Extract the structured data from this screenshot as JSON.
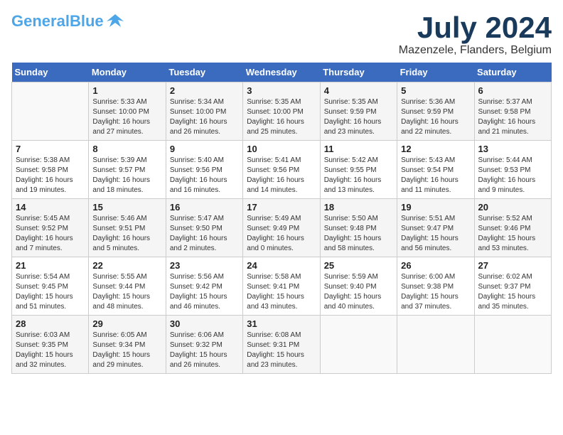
{
  "header": {
    "logo_general": "General",
    "logo_blue": "Blue",
    "month_year": "July 2024",
    "location": "Mazenzele, Flanders, Belgium"
  },
  "days_of_week": [
    "Sunday",
    "Monday",
    "Tuesday",
    "Wednesday",
    "Thursday",
    "Friday",
    "Saturday"
  ],
  "weeks": [
    [
      {
        "day": "",
        "info": ""
      },
      {
        "day": "1",
        "info": "Sunrise: 5:33 AM\nSunset: 10:00 PM\nDaylight: 16 hours\nand 27 minutes."
      },
      {
        "day": "2",
        "info": "Sunrise: 5:34 AM\nSunset: 10:00 PM\nDaylight: 16 hours\nand 26 minutes."
      },
      {
        "day": "3",
        "info": "Sunrise: 5:35 AM\nSunset: 10:00 PM\nDaylight: 16 hours\nand 25 minutes."
      },
      {
        "day": "4",
        "info": "Sunrise: 5:35 AM\nSunset: 9:59 PM\nDaylight: 16 hours\nand 23 minutes."
      },
      {
        "day": "5",
        "info": "Sunrise: 5:36 AM\nSunset: 9:59 PM\nDaylight: 16 hours\nand 22 minutes."
      },
      {
        "day": "6",
        "info": "Sunrise: 5:37 AM\nSunset: 9:58 PM\nDaylight: 16 hours\nand 21 minutes."
      }
    ],
    [
      {
        "day": "7",
        "info": "Sunrise: 5:38 AM\nSunset: 9:58 PM\nDaylight: 16 hours\nand 19 minutes."
      },
      {
        "day": "8",
        "info": "Sunrise: 5:39 AM\nSunset: 9:57 PM\nDaylight: 16 hours\nand 18 minutes."
      },
      {
        "day": "9",
        "info": "Sunrise: 5:40 AM\nSunset: 9:56 PM\nDaylight: 16 hours\nand 16 minutes."
      },
      {
        "day": "10",
        "info": "Sunrise: 5:41 AM\nSunset: 9:56 PM\nDaylight: 16 hours\nand 14 minutes."
      },
      {
        "day": "11",
        "info": "Sunrise: 5:42 AM\nSunset: 9:55 PM\nDaylight: 16 hours\nand 13 minutes."
      },
      {
        "day": "12",
        "info": "Sunrise: 5:43 AM\nSunset: 9:54 PM\nDaylight: 16 hours\nand 11 minutes."
      },
      {
        "day": "13",
        "info": "Sunrise: 5:44 AM\nSunset: 9:53 PM\nDaylight: 16 hours\nand 9 minutes."
      }
    ],
    [
      {
        "day": "14",
        "info": "Sunrise: 5:45 AM\nSunset: 9:52 PM\nDaylight: 16 hours\nand 7 minutes."
      },
      {
        "day": "15",
        "info": "Sunrise: 5:46 AM\nSunset: 9:51 PM\nDaylight: 16 hours\nand 5 minutes."
      },
      {
        "day": "16",
        "info": "Sunrise: 5:47 AM\nSunset: 9:50 PM\nDaylight: 16 hours\nand 2 minutes."
      },
      {
        "day": "17",
        "info": "Sunrise: 5:49 AM\nSunset: 9:49 PM\nDaylight: 16 hours\nand 0 minutes."
      },
      {
        "day": "18",
        "info": "Sunrise: 5:50 AM\nSunset: 9:48 PM\nDaylight: 15 hours\nand 58 minutes."
      },
      {
        "day": "19",
        "info": "Sunrise: 5:51 AM\nSunset: 9:47 PM\nDaylight: 15 hours\nand 56 minutes."
      },
      {
        "day": "20",
        "info": "Sunrise: 5:52 AM\nSunset: 9:46 PM\nDaylight: 15 hours\nand 53 minutes."
      }
    ],
    [
      {
        "day": "21",
        "info": "Sunrise: 5:54 AM\nSunset: 9:45 PM\nDaylight: 15 hours\nand 51 minutes."
      },
      {
        "day": "22",
        "info": "Sunrise: 5:55 AM\nSunset: 9:44 PM\nDaylight: 15 hours\nand 48 minutes."
      },
      {
        "day": "23",
        "info": "Sunrise: 5:56 AM\nSunset: 9:42 PM\nDaylight: 15 hours\nand 46 minutes."
      },
      {
        "day": "24",
        "info": "Sunrise: 5:58 AM\nSunset: 9:41 PM\nDaylight: 15 hours\nand 43 minutes."
      },
      {
        "day": "25",
        "info": "Sunrise: 5:59 AM\nSunset: 9:40 PM\nDaylight: 15 hours\nand 40 minutes."
      },
      {
        "day": "26",
        "info": "Sunrise: 6:00 AM\nSunset: 9:38 PM\nDaylight: 15 hours\nand 37 minutes."
      },
      {
        "day": "27",
        "info": "Sunrise: 6:02 AM\nSunset: 9:37 PM\nDaylight: 15 hours\nand 35 minutes."
      }
    ],
    [
      {
        "day": "28",
        "info": "Sunrise: 6:03 AM\nSunset: 9:35 PM\nDaylight: 15 hours\nand 32 minutes."
      },
      {
        "day": "29",
        "info": "Sunrise: 6:05 AM\nSunset: 9:34 PM\nDaylight: 15 hours\nand 29 minutes."
      },
      {
        "day": "30",
        "info": "Sunrise: 6:06 AM\nSunset: 9:32 PM\nDaylight: 15 hours\nand 26 minutes."
      },
      {
        "day": "31",
        "info": "Sunrise: 6:08 AM\nSunset: 9:31 PM\nDaylight: 15 hours\nand 23 minutes."
      },
      {
        "day": "",
        "info": ""
      },
      {
        "day": "",
        "info": ""
      },
      {
        "day": "",
        "info": ""
      }
    ]
  ]
}
